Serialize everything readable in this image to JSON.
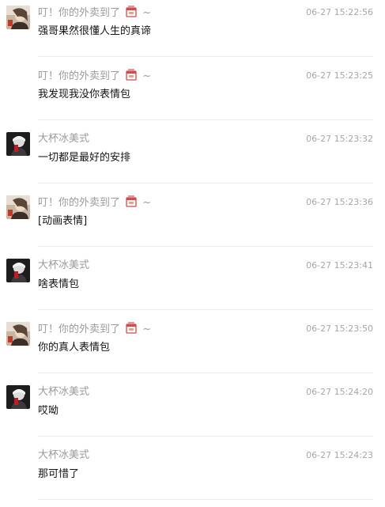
{
  "messages": [
    {
      "sender": "叮！你的外卖到了",
      "tail": "~",
      "time": "06-27 15:22:56",
      "text": "强哥果然很懂人生的真谛",
      "avatar": "girl-avatar"
    },
    {
      "sender": "叮！你的外卖到了",
      "tail": "~",
      "time": "06-27 15:23:25",
      "text": "我发现我没你表情包",
      "avatar": ""
    },
    {
      "sender": "大杯冰美式",
      "tail": "",
      "time": "06-27 15:23:32",
      "text": "一切都是最好的安排",
      "avatar": "dark-avatar"
    },
    {
      "sender": "叮！你的外卖到了",
      "tail": "~",
      "time": "06-27 15:23:36",
      "text": "[动画表情]",
      "avatar": "girl-avatar"
    },
    {
      "sender": "大杯冰美式",
      "tail": "",
      "time": "06-27 15:23:41",
      "text": "啥表情包",
      "avatar": "dark-avatar"
    },
    {
      "sender": "叮！你的外卖到了",
      "tail": "~",
      "time": "06-27 15:23:50",
      "text": "你的真人表情包",
      "avatar": "girl-avatar"
    },
    {
      "sender": "大杯冰美式",
      "tail": "",
      "time": "06-27 15:24:20",
      "text": "哎呦",
      "avatar": "dark-avatar"
    },
    {
      "sender": "大杯冰美式",
      "tail": "",
      "time": "06-27 15:24:23",
      "text": "那可惜了",
      "avatar": ""
    }
  ]
}
